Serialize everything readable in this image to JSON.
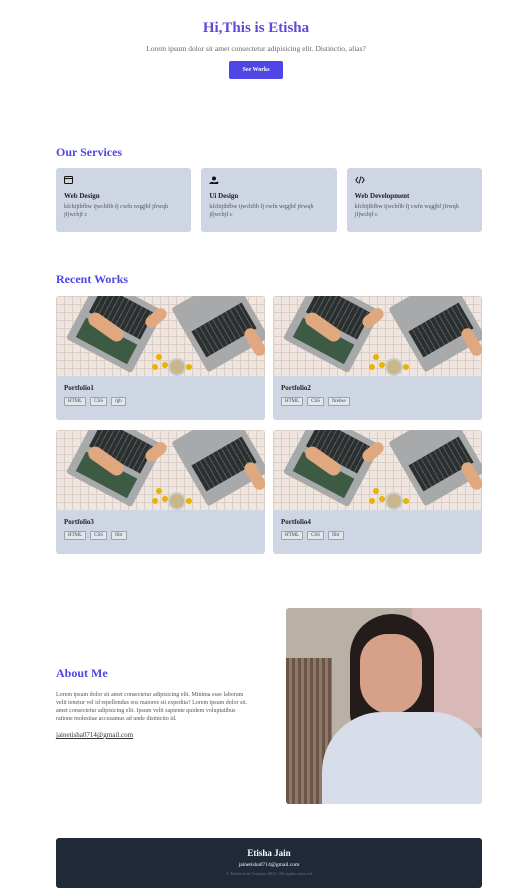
{
  "hero": {
    "title": "Hi,This is Etisha",
    "subtitle": "Lorem ipsum dolor sit amet consectetur adipisicing elit. Distinctio, alias?",
    "button": "See Works"
  },
  "services": {
    "heading": "Our Services",
    "items": [
      {
        "icon": "browser-window-icon",
        "title": "Web Design",
        "desc": "kfcbijtbfbw ijwcbfib fj cwfn wqgjbf jfrwqh jfjwcbjf c"
      },
      {
        "icon": "hand-holding-icon",
        "title": "Ui Design",
        "desc": "kfcbijtbfbw ijwcbfib fj cwfn wqgjbf jfrwqh jfjwcbjf c"
      },
      {
        "icon": "code-icon",
        "title": "Web Development",
        "desc": "kfcbijtbfbw ijwcbfib fj cwfn wqgjbf jfrwqh jfjwcbjf c"
      }
    ]
  },
  "works": {
    "heading": "Recent Works",
    "items": [
      {
        "title": "Portfolio1",
        "tags": [
          "HTML",
          "CSS",
          "rgb"
        ]
      },
      {
        "title": "Portfolio2",
        "tags": [
          "HTML",
          "CSS",
          "firebse"
        ]
      },
      {
        "title": "Portfolio3",
        "tags": [
          "HTML",
          "CSS",
          "filtr"
        ]
      },
      {
        "title": "Portfolio4",
        "tags": [
          "HTML",
          "CSS",
          "filtr"
        ]
      }
    ]
  },
  "about": {
    "heading": "About Me",
    "text": "Lorem ipsum dolor sit amet consectetur adipisicing elit. Minima esse laborum velit tenetur vel id repellendus eos maiores sit expedita? Lorem ipsum dolor sit. amet consectetur adipisicing elit. Ipsum velit sapiente quidem voluptatibus ratione molestiae accusamus ad unde distinctio id.",
    "email": "jainetisha0714@gmail.com"
  },
  "footer": {
    "name": "Etisha Jain",
    "email": "jainetisha0714@gmail.com",
    "copyright": "© Etisha Jain Creation 2022. All rights reserved"
  },
  "colors": {
    "accent": "#4f46e5",
    "card": "#cdd6e2",
    "footer": "#1f2937"
  }
}
